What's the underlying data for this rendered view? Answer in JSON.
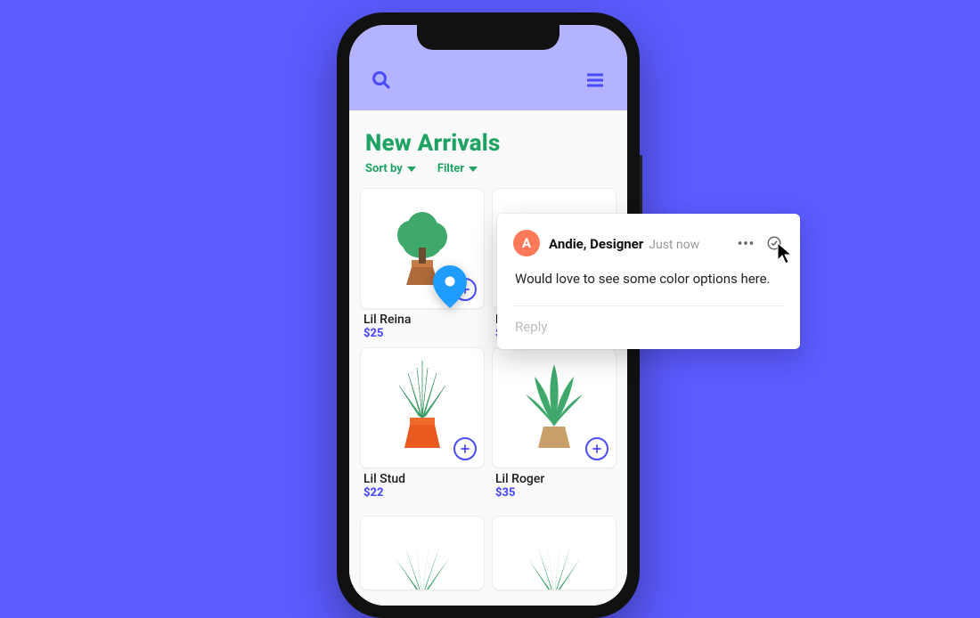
{
  "colors": {
    "background": "#5B5BFF",
    "accent_green": "#1EA362",
    "accent_blue": "#4A4AFF",
    "header_lavender": "#B3B3FF",
    "avatar": "#FF7A59"
  },
  "app": {
    "page_title": "New Arrivals",
    "controls": {
      "sort_label": "Sort by",
      "filter_label": "Filter"
    },
    "products": [
      {
        "name": "Lil Reina",
        "price": "$25"
      },
      {
        "name": "L",
        "price": "$"
      },
      {
        "name": "Lil Stud",
        "price": "$22"
      },
      {
        "name": "Lil Roger",
        "price": "$35"
      }
    ]
  },
  "comment": {
    "avatar_initial": "A",
    "author": "Andie, Designer",
    "timestamp": "Just now",
    "body": "Would love to see some color options here.",
    "reply_placeholder": "Reply"
  }
}
